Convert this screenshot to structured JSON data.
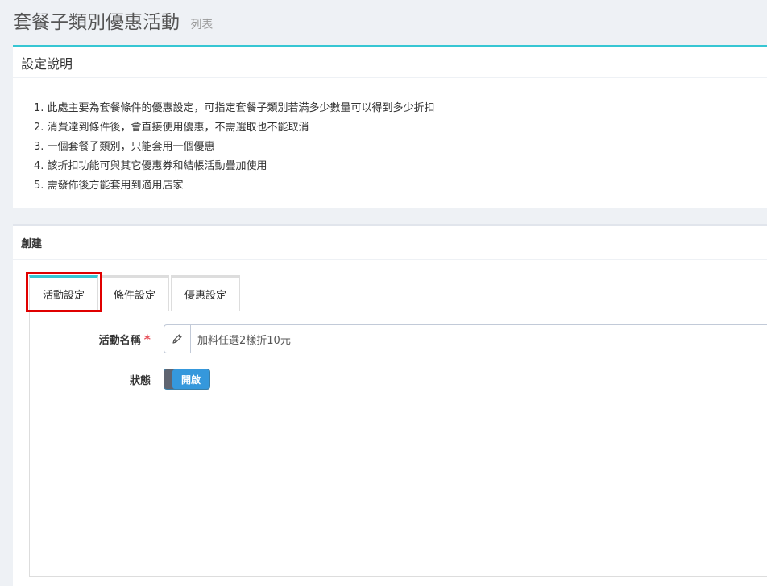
{
  "page": {
    "title": "套餐子類別優惠活動",
    "subtitle": "列表"
  },
  "info": {
    "title": "設定說明",
    "items": [
      "1. 此處主要為套餐條件的優惠設定，可指定套餐子類別若滿多少數量可以得到多少折扣",
      "2. 消費達到條件後，會直接使用優惠，不需選取也不能取消",
      "3. 一個套餐子類別，只能套用一個優惠",
      "4. 該折扣功能可與其它優惠券和結帳活動疊加使用",
      "5. 需發佈後方能套用到適用店家"
    ]
  },
  "create": {
    "title": "創建",
    "tabs": [
      {
        "label": "活動設定",
        "active": true
      },
      {
        "label": "條件設定",
        "active": false
      },
      {
        "label": "優惠設定",
        "active": false
      }
    ],
    "form": {
      "name_label": "活動名稱",
      "required_mark": "*",
      "name_value": "加料任選2樣折10元",
      "name_icon": "pencil-icon",
      "status_label": "狀態",
      "status_value": "開啟"
    }
  },
  "colors": {
    "accent": "#36c6d3",
    "toggle_on": "#3598dc",
    "highlight": "#e00000"
  }
}
